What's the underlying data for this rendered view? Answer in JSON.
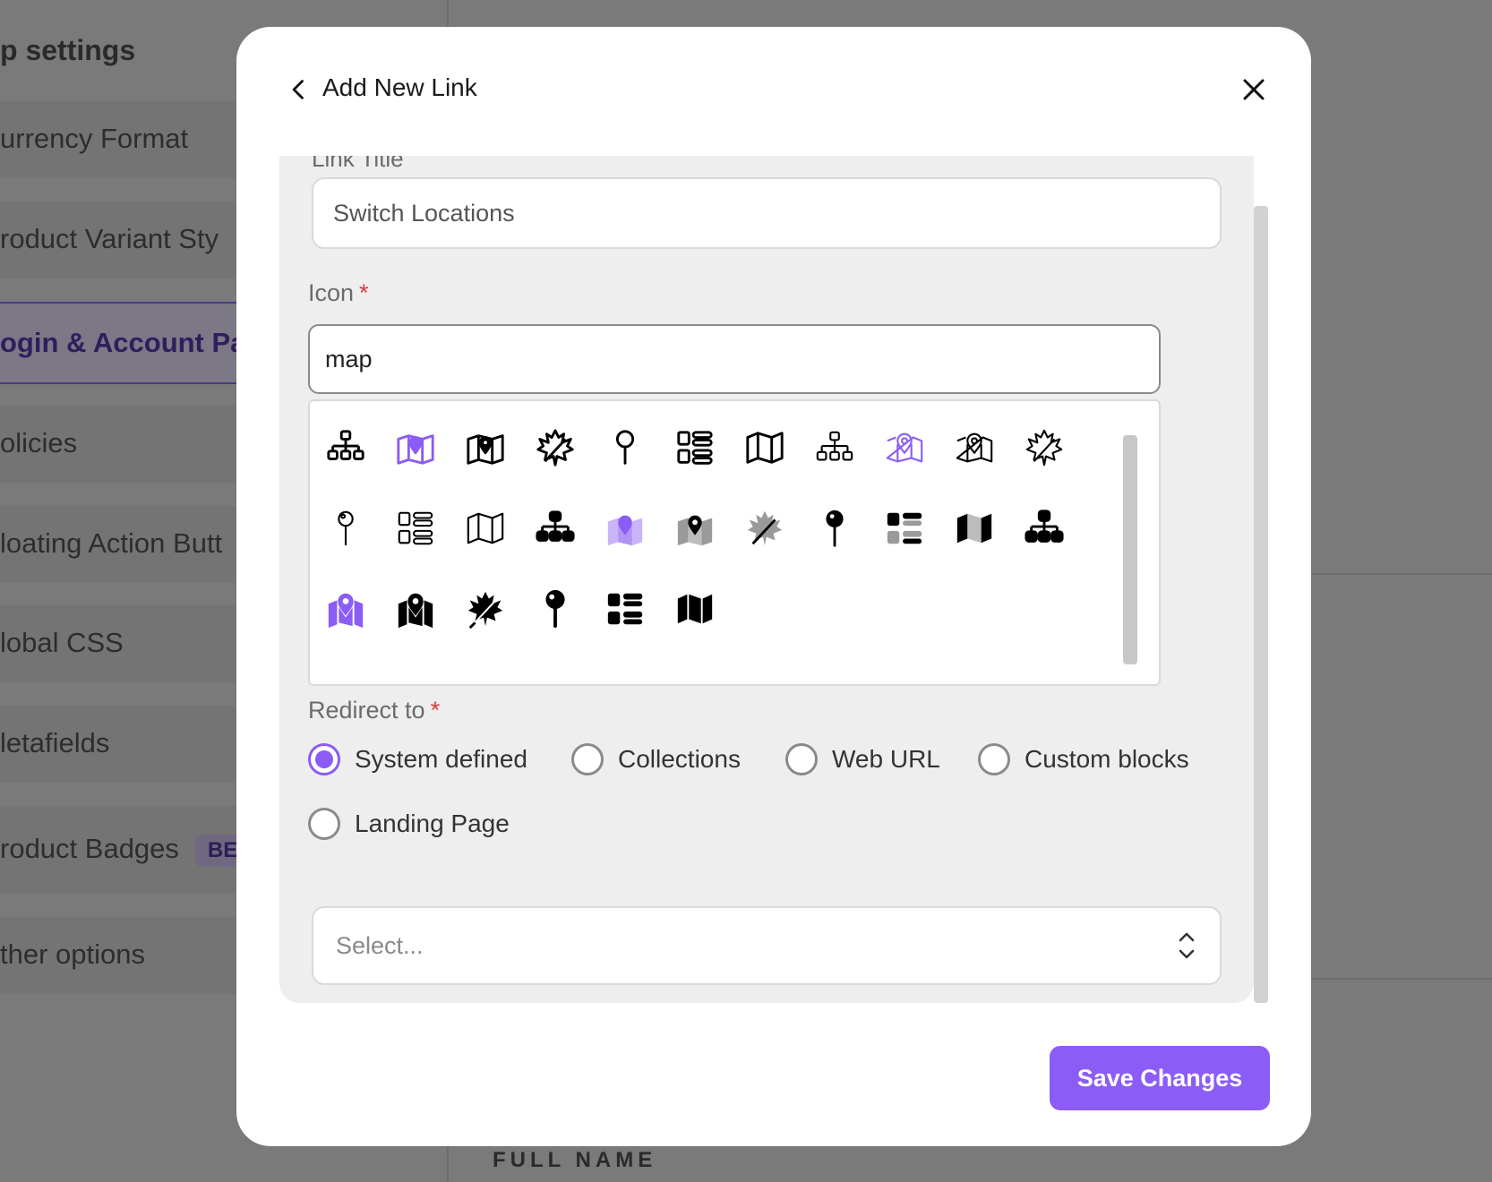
{
  "background": {
    "sidebar_title": "p settings",
    "items": [
      {
        "label": "urrency Format"
      },
      {
        "label": "roduct Variant Sty"
      },
      {
        "label": "ogin & Account Pa"
      },
      {
        "label": "olicies"
      },
      {
        "label": "loating Action Butt"
      },
      {
        "label": "lobal CSS"
      },
      {
        "label": "letafields"
      },
      {
        "label": "roduct Badges"
      },
      {
        "label": "ther options"
      }
    ],
    "badge": "BE",
    "footer_label": "FULL NAME"
  },
  "modal": {
    "title": "Add New Link",
    "back_icon": "chevron-left-icon",
    "close_icon": "close-icon"
  },
  "form": {
    "link_title_label": "Link Title",
    "link_title_value": "Switch Locations",
    "icon_label": "Icon",
    "icon_search_value": "map",
    "icons": [
      {
        "name": "sitemap-outline-icon",
        "color": "#000000"
      },
      {
        "name": "map-pin-location-purple-icon",
        "color": "#8b5cf6"
      },
      {
        "name": "map-pin-location-outline-icon",
        "color": "#000000"
      },
      {
        "name": "maple-leaf-outline-icon",
        "color": "#000000"
      },
      {
        "name": "map-pin-outline-icon",
        "color": "#000000"
      },
      {
        "name": "layout-list-outline-icon",
        "color": "#000000"
      },
      {
        "name": "map-outline-icon",
        "color": "#000000"
      },
      {
        "name": "sitemap-thin-icon",
        "color": "#000000"
      },
      {
        "name": "map-pin-location-thin-purple-icon",
        "color": "#8b5cf6"
      },
      {
        "name": "map-pin-location-thin-icon",
        "color": "#000000"
      },
      {
        "name": "maple-leaf-thin-icon",
        "color": "#000000"
      },
      {
        "name": "map-pin-thin-icon",
        "color": "#000000"
      },
      {
        "name": "layout-list-thin-icon",
        "color": "#000000"
      },
      {
        "name": "map-thin-icon",
        "color": "#000000"
      },
      {
        "name": "sitemap-solid-icon",
        "color": "#000000"
      },
      {
        "name": "map-location-duotone-purple-icon",
        "color": "#8b5cf6"
      },
      {
        "name": "map-location-duotone-icon",
        "color": "#000000"
      },
      {
        "name": "maple-leaf-duotone-icon",
        "color": "#000000"
      },
      {
        "name": "map-pin-solid-icon",
        "color": "#000000"
      },
      {
        "name": "layout-list-duotone-icon",
        "color": "#000000"
      },
      {
        "name": "map-duotone-icon",
        "color": "#000000"
      },
      {
        "name": "sitemap-bold-icon",
        "color": "#000000"
      },
      {
        "name": "map-location-solid-purple-icon",
        "color": "#8b5cf6"
      },
      {
        "name": "map-location-solid-icon",
        "color": "#000000"
      },
      {
        "name": "maple-leaf-solid-icon",
        "color": "#000000"
      },
      {
        "name": "map-pin-bold-icon",
        "color": "#000000"
      },
      {
        "name": "layout-list-solid-icon",
        "color": "#000000"
      },
      {
        "name": "map-solid-icon",
        "color": "#000000"
      }
    ],
    "redirect_label": "Redirect to",
    "redirect_options": [
      {
        "label": "System defined",
        "checked": true
      },
      {
        "label": "Collections",
        "checked": false
      },
      {
        "label": "Web URL",
        "checked": false
      },
      {
        "label": "Custom blocks",
        "checked": false
      },
      {
        "label": "Landing Page",
        "checked": false
      }
    ],
    "select_placeholder": "Select..."
  },
  "actions": {
    "save_label": "Save Changes"
  },
  "colors": {
    "accent": "#8b5cf6",
    "required": "#d93a3a",
    "overlay": "#7a7a7a"
  }
}
